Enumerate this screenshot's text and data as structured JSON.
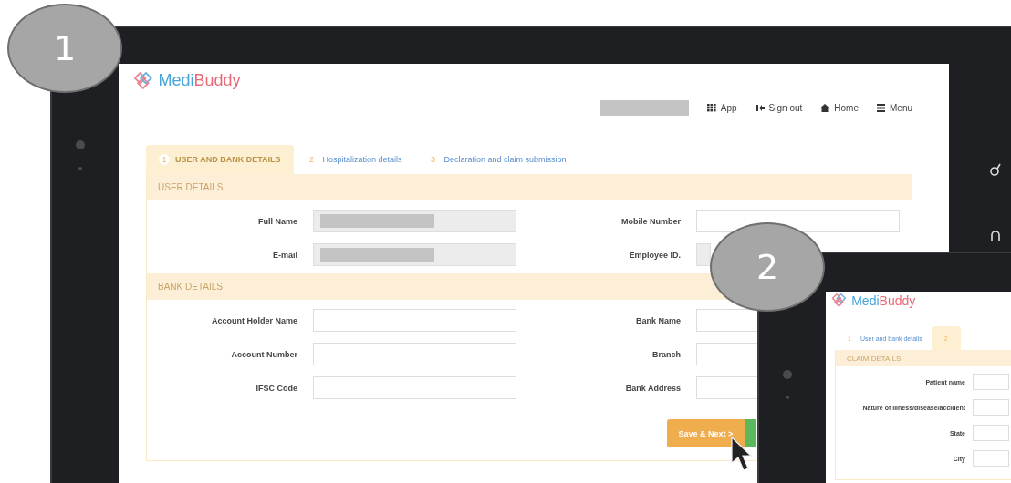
{
  "callouts": [
    {
      "label": "1"
    },
    {
      "label": "2"
    }
  ],
  "screen_1": {
    "logo": {
      "part_1": "Medi",
      "part_2": "Buddy"
    },
    "nav": [
      {
        "kind": "redacted"
      },
      {
        "kind": "grid",
        "label": "App"
      },
      {
        "kind": "signout",
        "label": "Sign out"
      },
      {
        "kind": "home",
        "label": "Home"
      },
      {
        "kind": "menu",
        "label": "Menu"
      }
    ],
    "tabs": [
      {
        "number": "1",
        "label": "USER AND BANK DETAILS",
        "selected": true
      },
      {
        "number": "2",
        "label": "Hospitalization details",
        "selected": false
      },
      {
        "number": "3",
        "label": "Declaration and claim submission",
        "selected": false
      }
    ],
    "sections": [
      {
        "title": "USER DETAILS",
        "left": [
          {
            "label": "Full Name",
            "kind": "redacted"
          },
          {
            "label": "E-mail",
            "kind": "redacted"
          }
        ],
        "right": [
          {
            "label": "Mobile Number",
            "kind": "empty"
          },
          {
            "label": "Employee ID.",
            "kind": "redacted"
          }
        ]
      },
      {
        "title": "BANK DETAILS",
        "left": [
          {
            "label": "Account Holder Name",
            "kind": "empty"
          },
          {
            "label": "Account Number",
            "kind": "empty"
          },
          {
            "label": "IFSC Code",
            "kind": "empty"
          }
        ],
        "right": [
          {
            "label": "Bank Name",
            "kind": "empty"
          },
          {
            "label": "Branch",
            "kind": "empty"
          },
          {
            "label": "Bank Address",
            "kind": "empty"
          }
        ]
      }
    ],
    "buttons": [
      {
        "kind": "primary",
        "label": "Save & Next >"
      },
      {
        "kind": "success"
      }
    ]
  },
  "screen_2": {
    "logo": {
      "part_1": "Medi",
      "part_2": "Buddy"
    },
    "tabs": [
      {
        "number": "1",
        "label": "User and bank details",
        "selected": false
      },
      {
        "number": "2",
        "selected": true
      }
    ],
    "section": {
      "title": "CLAIM DETAILS",
      "rows": [
        {
          "label": "Patient name"
        },
        {
          "label": "Nature of illness/disease/accident"
        },
        {
          "label": "State"
        },
        {
          "label": "City"
        }
      ]
    }
  }
}
